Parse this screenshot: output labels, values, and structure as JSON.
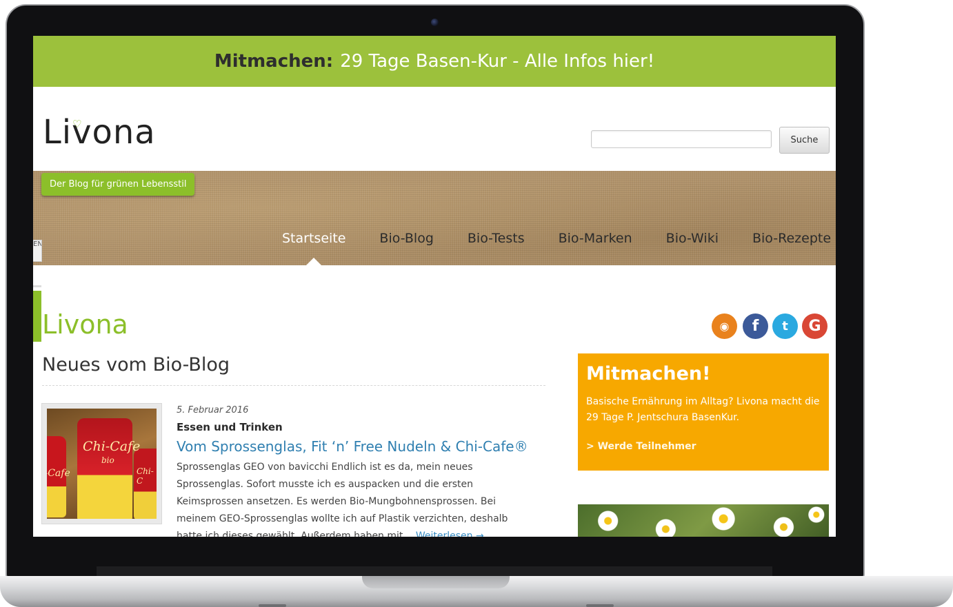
{
  "promo": {
    "bold": "Mitmachen:",
    "text": "29 Tage Basen-Kur - Alle Infos hier!"
  },
  "header": {
    "logo": "Livona",
    "search": {
      "placeholder": "",
      "button": "Suche"
    }
  },
  "tagline": "Der Blog für grünen Lebensstil",
  "nav_stub": "EN",
  "nav": {
    "items": [
      {
        "label": "Startseite",
        "active": true
      },
      {
        "label": "Bio-Blog"
      },
      {
        "label": "Bio-Tests"
      },
      {
        "label": "Bio-Marken"
      },
      {
        "label": "Bio-Wiki"
      },
      {
        "label": "Bio-Rezepte"
      }
    ]
  },
  "main": {
    "title": "Livona",
    "section_title": "Neues vom Bio-Blog",
    "post": {
      "date": "5. Februar 2016",
      "category": "Essen und Trinken",
      "title": "Vom Sprossenglas, Fit ‘n’ Free Nudeln & Chi-Cafe®",
      "excerpt": "Sprossenglas GEO von bavicchi Endlich ist es da, mein neues Sprossenglas. Sofort musste ich es auspacken und die ersten Keimsprossen ansetzen. Es werden Bio-Mungbohnensprossen. Bei meinem GEO-Sprossenglas wollte ich auf Plastik verzichten, deshalb hatte ich dieses gewählt. Außerdem haben mit…",
      "read_more": "Weiterlesen →",
      "image_labels": {
        "brand": "Chi-Cafe",
        "sub": "bio",
        "left": "i-Cafe",
        "right": "Chi-C"
      }
    }
  },
  "sidebar": {
    "social": [
      {
        "name": "rss-icon",
        "glyph": "◉",
        "color": "#e9821d"
      },
      {
        "name": "facebook-icon",
        "glyph": "f",
        "color": "#3c5a99"
      },
      {
        "name": "twitter-icon",
        "glyph": "t",
        "color": "#2aa9e0"
      },
      {
        "name": "google-plus-icon",
        "glyph": "G",
        "color": "#d94735"
      }
    ],
    "widget": {
      "title": "Mitmachen!",
      "text": "Basische Ernährung im Alltag? Livona macht die 29 Tage P. Jentschura BasenKur.",
      "cta": "> Werde Teilnehmer"
    }
  },
  "colors": {
    "green": "#8cbf2a",
    "promo_green": "#9cc13c",
    "orange": "#f7a800",
    "link_blue": "#2f7fb0"
  }
}
